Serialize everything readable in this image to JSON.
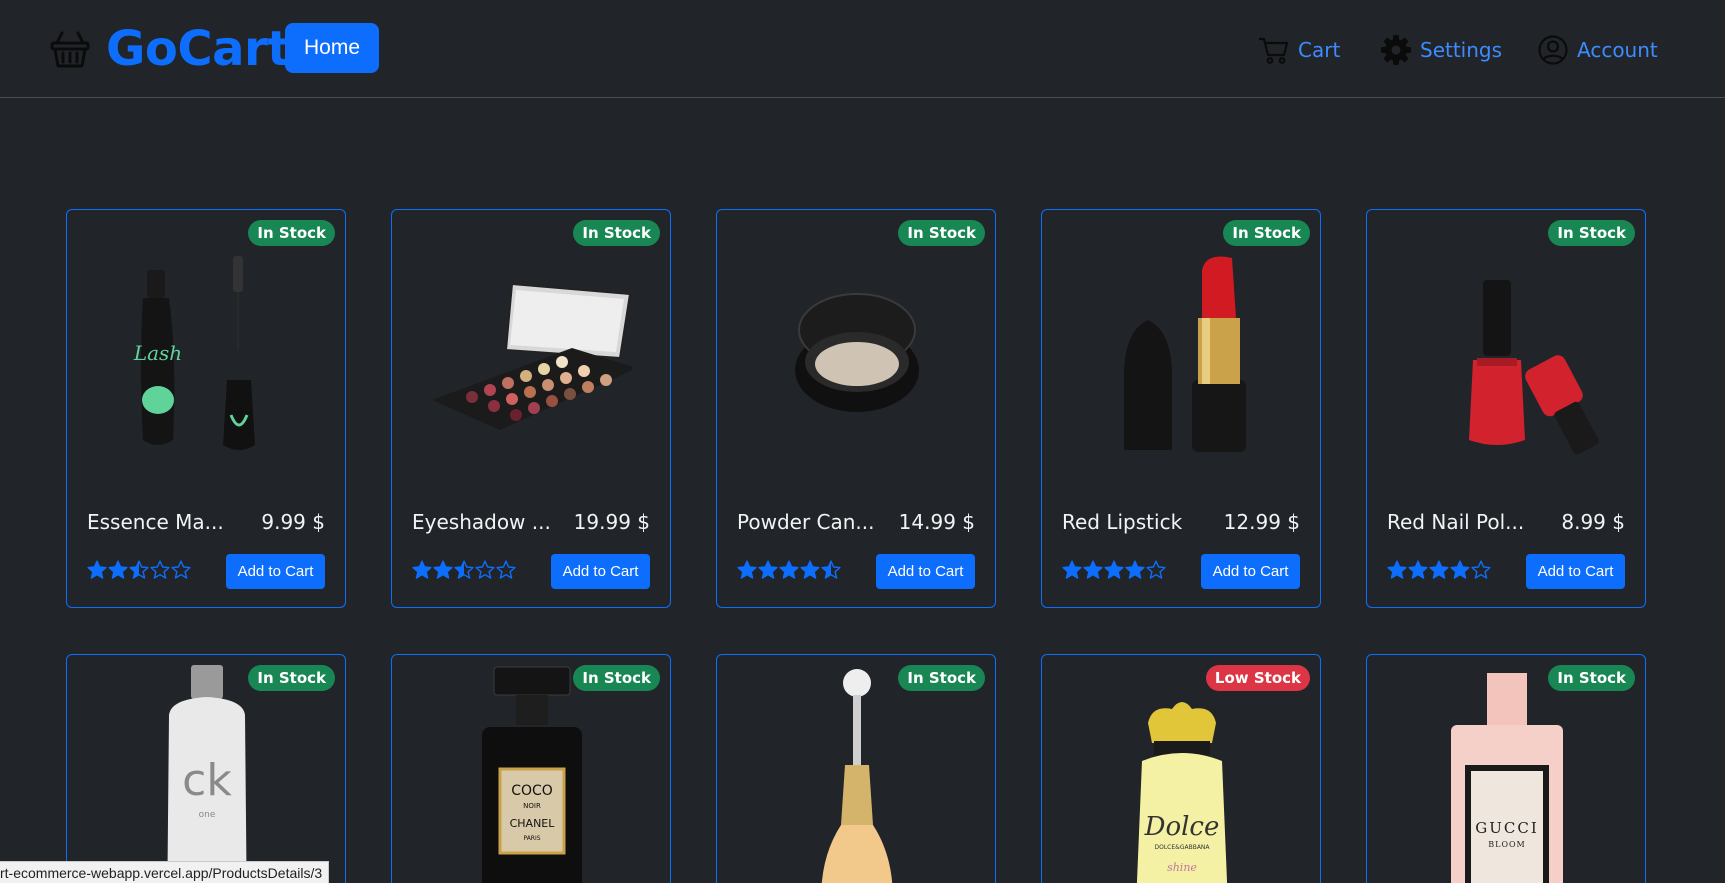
{
  "header": {
    "brand": "GoCart",
    "home_label": "Home",
    "nav": {
      "cart_label": "Cart",
      "settings_label": "Settings",
      "account_label": "Account"
    }
  },
  "add_to_cart_label": "Add to Cart",
  "products": [
    {
      "title": "Essence Ma...",
      "price": "9.99 $",
      "stock": "In Stock",
      "rating": 2.5
    },
    {
      "title": "Eyeshadow ...",
      "price": "19.99 $",
      "stock": "In Stock",
      "rating": 2.5
    },
    {
      "title": "Powder Can...",
      "price": "14.99 $",
      "stock": "In Stock",
      "rating": 4.5
    },
    {
      "title": "Red Lipstick",
      "price": "12.99 $",
      "stock": "In Stock",
      "rating": 4
    },
    {
      "title": "Red Nail Pol...",
      "price": "8.99 $",
      "stock": "In Stock",
      "rating": 4
    },
    {
      "stock": "In Stock",
      "image_text": [
        "ck",
        "one"
      ]
    },
    {
      "stock": "In Stock",
      "image_text": [
        "COCO",
        "NOIR",
        "CHANEL",
        "PARIS"
      ]
    },
    {
      "stock": "In Stock"
    },
    {
      "stock": "Low Stock",
      "image_text": [
        "Dolce",
        "DOLCE&GABBANA",
        "shine"
      ]
    },
    {
      "stock": "In Stock",
      "image_text": [
        "GUCCI",
        "BLOOM"
      ]
    }
  ],
  "status_bar": {
    "url": "rt-ecommerce-webapp.vercel.app/ProductsDetails/3"
  },
  "colors": {
    "background": "#212529",
    "accent": "#0d6efd",
    "link": "#3d8bfd",
    "in_stock": "#198754",
    "low_stock": "#dc3545"
  },
  "icons": {
    "brand": "basket-icon",
    "cart": "cart-icon",
    "settings": "gear-icon",
    "account": "person-circle-icon",
    "rating": "star-icon"
  }
}
